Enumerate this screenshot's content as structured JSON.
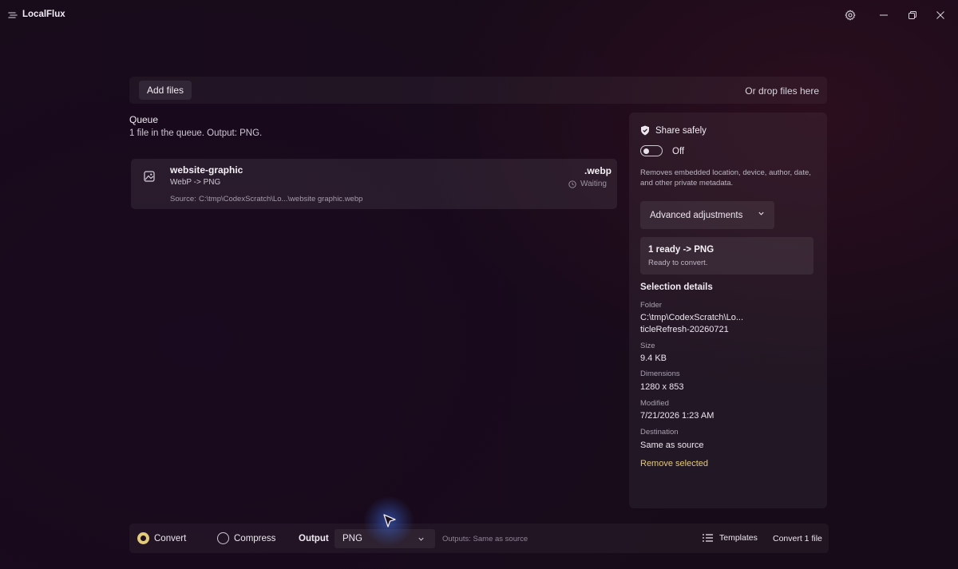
{
  "app": {
    "title": "LocalFlux"
  },
  "dropbar": {
    "add_files_label": "Add files",
    "drop_hint": "Or drop files here"
  },
  "queue": {
    "title": "Queue",
    "summary": "1 file in the queue. Output: PNG.",
    "items": [
      {
        "name": "website-graphic",
        "conversion": "WebP -> PNG",
        "source_label": "Source:",
        "source_path": "C:\\tmp\\CodexScratch\\Lo...\\website graphic.webp",
        "extension": ".webp",
        "status": "Waiting"
      }
    ]
  },
  "panel": {
    "share_title": "Share safely",
    "share_state": "Off",
    "share_description": "Removes embedded location, device, author, date, and other private metadata.",
    "advanced_label": "Advanced adjustments",
    "ready_title": "1 ready -> PNG",
    "ready_sub": "Ready to convert.",
    "details_title": "Selection details",
    "details": {
      "folder_label": "Folder",
      "folder_line1": "C:\\tmp\\CodexScratch\\Lo...",
      "folder_line2": "ticleRefresh-20260721",
      "size_label": "Size",
      "size_value": "9.4 KB",
      "dimensions_label": "Dimensions",
      "dimensions_value": "1280 x 853",
      "modified_label": "Modified",
      "modified_value": "7/21/2026 1:23 AM",
      "destination_label": "Destination",
      "destination_value": "Same as source"
    },
    "remove_label": "Remove selected"
  },
  "bottombar": {
    "mode_convert": "Convert",
    "mode_compress": "Compress",
    "selected_mode": "Convert",
    "output_label": "Output",
    "output_value": "PNG",
    "outputs_note": "Outputs: Same as source",
    "templates_label": "Templates",
    "convert_button": "Convert 1 file"
  },
  "colors": {
    "accent": "#e3c97a",
    "background": "#170b19"
  },
  "icons": [
    "app-logo-icon",
    "gear-icon",
    "minimize-icon",
    "restore-icon",
    "close-icon",
    "image-file-icon",
    "clock-icon",
    "shield-icon",
    "chevron-down-icon",
    "list-icon",
    "cursor-icon"
  ]
}
